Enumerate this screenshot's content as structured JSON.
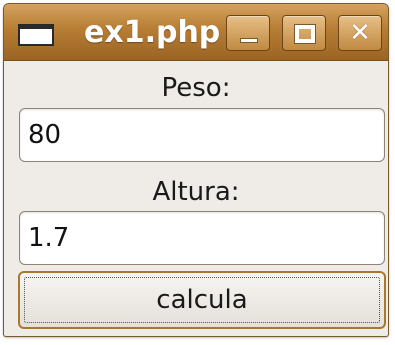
{
  "window": {
    "title": "ex1.php",
    "icons": {
      "app": "window-app-icon",
      "minimize": "minimize-icon",
      "maximize": "maximize-icon",
      "close": "close-icon"
    },
    "close_glyph": "✕"
  },
  "form": {
    "peso_label": "Peso:",
    "peso_value": "80",
    "altura_label": "Altura:",
    "altura_value": "1.7",
    "button_label": "calcula"
  },
  "colors": {
    "titlebar": "#b67d33",
    "accent_border": "#a8782f",
    "window_bg": "#efebe7"
  }
}
